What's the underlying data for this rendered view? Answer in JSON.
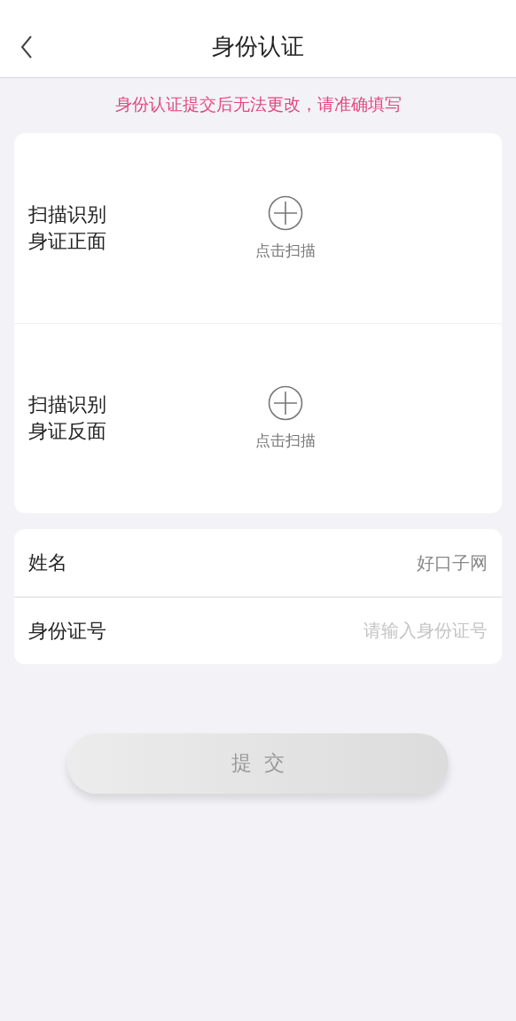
{
  "header": {
    "title": "身份认证"
  },
  "notice": "身份认证提交后无法更改，请准确填写",
  "scan_items": [
    {
      "label_lines": [
        "扫描识别",
        "身证正面"
      ],
      "action": "点击扫描"
    },
    {
      "label_lines": [
        "扫描识别",
        "身证反面"
      ],
      "action": "点击扫描"
    }
  ],
  "fields": [
    {
      "label": "姓名",
      "value": "好口子网"
    },
    {
      "label": "身份证号",
      "placeholder": "请输入身份证号"
    }
  ],
  "submit": {
    "label": "提交",
    "disabled": true
  }
}
